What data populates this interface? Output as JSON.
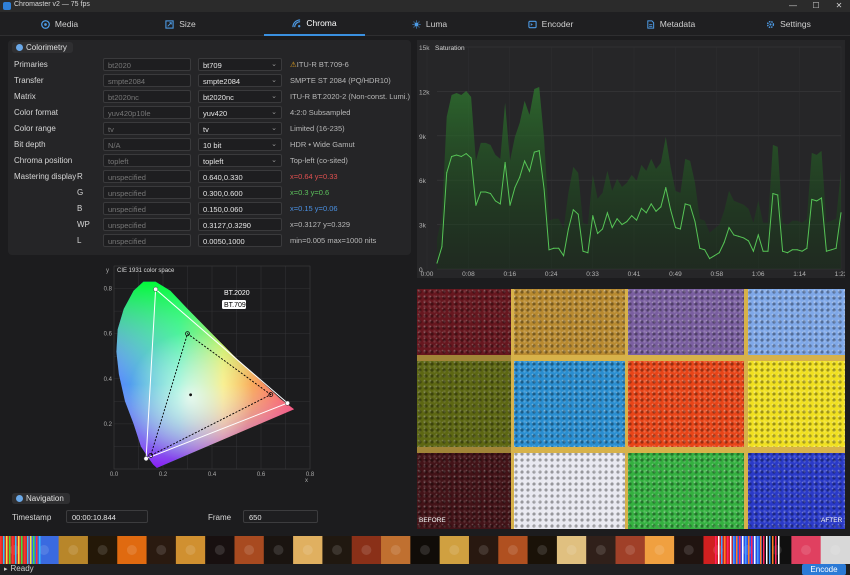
{
  "window": {
    "title": "Chromaster v2 — 75 fps",
    "minimize": "—",
    "maximize": "☐",
    "close": "✕"
  },
  "tabs": [
    {
      "label": "Media",
      "icon": "media-icon"
    },
    {
      "label": "Size",
      "icon": "size-icon"
    },
    {
      "label": "Chroma",
      "icon": "chroma-icon",
      "active": true
    },
    {
      "label": "Luma",
      "icon": "luma-icon"
    },
    {
      "label": "Encoder",
      "icon": "encoder-icon"
    },
    {
      "label": "Metadata",
      "icon": "metadata-icon"
    },
    {
      "label": "Settings",
      "icon": "settings-icon"
    }
  ],
  "colorimetry": {
    "title": "Colorimetry",
    "rows": [
      {
        "label": "Primaries",
        "sub": "",
        "src": "bt2020",
        "dst": "bt709",
        "dropdown": true,
        "info": "ITU-R BT.709-6",
        "warn": true
      },
      {
        "label": "Transfer",
        "sub": "",
        "src": "smpte2084",
        "dst": "smpte2084",
        "dropdown": true,
        "info": "SMPTE ST 2084 (PQ/HDR10)"
      },
      {
        "label": "Matrix",
        "sub": "",
        "src": "bt2020nc",
        "dst": "bt2020nc",
        "dropdown": true,
        "info": "ITU-R BT.2020-2 (Non-const. Lumi.)"
      },
      {
        "label": "Color format",
        "sub": "",
        "src": "yuv420p10le",
        "dst": "yuv420",
        "dropdown": true,
        "info": "4:2:0 Subsampled"
      },
      {
        "label": "Color range",
        "sub": "",
        "src": "tv",
        "dst": "tv",
        "dropdown": true,
        "info": "Limited (16-235)"
      },
      {
        "label": "Bit depth",
        "sub": "",
        "src": "N/A",
        "dst": "10 bit",
        "dropdown": true,
        "info": "HDR • Wide Gamut"
      },
      {
        "label": "Chroma position",
        "sub": "",
        "src": "topleft",
        "dst": "topleft",
        "dropdown": true,
        "info": "Top-left (co-sited)"
      },
      {
        "label": "Mastering display",
        "sub": "R",
        "src": "unspecified",
        "dst": "0.640,0.330",
        "dropdown": false,
        "info": "x=0.64 y=0.33",
        "info_color": "#e05050"
      },
      {
        "label": "",
        "sub": "G",
        "src": "unspecified",
        "dst": "0.300,0.600",
        "dropdown": false,
        "info": "x=0.3 y=0.6",
        "info_color": "#5cc15c"
      },
      {
        "label": "",
        "sub": "B",
        "src": "unspecified",
        "dst": "0.150,0.060",
        "dropdown": false,
        "info": "x=0.15 y=0.06",
        "info_color": "#4a90e2"
      },
      {
        "label": "",
        "sub": "WP",
        "src": "unspecified",
        "dst": "0.3127,0.3290",
        "dropdown": false,
        "info": "x=0.3127 y=0.329"
      },
      {
        "label": "",
        "sub": "L",
        "src": "unspecified",
        "dst": "0.0050,1000",
        "dropdown": false,
        "info": "min=0.005 max=1000 nits"
      }
    ]
  },
  "chart_data": [
    {
      "type": "line",
      "title": "Saturation",
      "color": "#56c456",
      "ylim": [
        0,
        15000
      ],
      "yticks": [
        "15k",
        "12k",
        "9k",
        "6k",
        "3k",
        "0"
      ],
      "xticks": [
        "0:00",
        "0:08",
        "0:16",
        "0:24",
        "0:33",
        "0:41",
        "0:49",
        "0:58",
        "1:06",
        "1:14",
        "1:23"
      ],
      "x": [
        0,
        1,
        2,
        3,
        4,
        5,
        6,
        7,
        8,
        9,
        10,
        11,
        12,
        13,
        14,
        15,
        16,
        17,
        18,
        19,
        20,
        21,
        22,
        23,
        24,
        25,
        26,
        27,
        28,
        29,
        30,
        31,
        32,
        33,
        34,
        35,
        36,
        37,
        38,
        39,
        40,
        41,
        42,
        43,
        44,
        45,
        46,
        47,
        48,
        49,
        50,
        51,
        52,
        53,
        54,
        55,
        56,
        57,
        58,
        59,
        60,
        61,
        62,
        63,
        64,
        65,
        66,
        67,
        68,
        69,
        70,
        71,
        72,
        73,
        74,
        75,
        76,
        77,
        78,
        79,
        80,
        81,
        82,
        83
      ],
      "y": [
        400,
        1500,
        6500,
        7600,
        7700,
        7600,
        7800,
        7500,
        4300,
        5200,
        5200,
        5100,
        4600,
        4400,
        7200,
        4300,
        5500,
        6200,
        7300,
        6600,
        7900,
        8000,
        5400,
        1300,
        1400,
        1400,
        900,
        2700,
        4000,
        3700,
        1200,
        1100,
        3600,
        2400,
        2700,
        3800,
        2800,
        3400,
        3000,
        3200,
        3600,
        3300,
        4100,
        3800,
        4400,
        3900,
        4200,
        5500,
        4000,
        2800,
        2700,
        4400,
        4300,
        3200,
        1400,
        1300,
        700,
        900,
        1100,
        1800,
        2800,
        2300,
        2200,
        2100,
        1900,
        1200,
        2300,
        1200,
        1200,
        5100,
        5000,
        1200,
        1100,
        1300,
        1300,
        1200,
        1400,
        4700,
        4600,
        4800,
        1200,
        1300,
        1400,
        3800
      ],
      "xlabel": "",
      "ylabel": "",
      "grid": true
    },
    {
      "type": "scatter",
      "title": "CIE 1931 color space",
      "xlabel": "x",
      "ylabel": "y",
      "xlim": [
        0,
        0.8
      ],
      "ylim": [
        0,
        0.9
      ],
      "xticks": [
        "0.0",
        "0.2",
        "0.4",
        "0.6",
        "0.8"
      ],
      "yticks": [
        "0.2",
        "0.4",
        "0.6",
        "0.8"
      ],
      "series": [
        {
          "name": "BT.2020",
          "x": [
            0.708,
            0.17,
            0.131
          ],
          "y": [
            0.292,
            0.797,
            0.046
          ]
        },
        {
          "name": "BT.709",
          "x": [
            0.64,
            0.3,
            0.15
          ],
          "y": [
            0.33,
            0.6,
            0.06
          ]
        }
      ],
      "white_point": [
        0.3127,
        0.329
      ]
    }
  ],
  "compare": {
    "before": "BEFORE",
    "after": "AFTER"
  },
  "navigation": {
    "title": "Navigation",
    "timestamp_label": "Timestamp",
    "timestamp_value": "00:00:10.844",
    "frame_label": "Frame",
    "frame_value": "650"
  },
  "status": {
    "text": "Ready",
    "encode_label": "Encode"
  },
  "colors": {
    "accent": "#2b7ad6",
    "green": "#56c456",
    "warn": "#e0a020"
  }
}
